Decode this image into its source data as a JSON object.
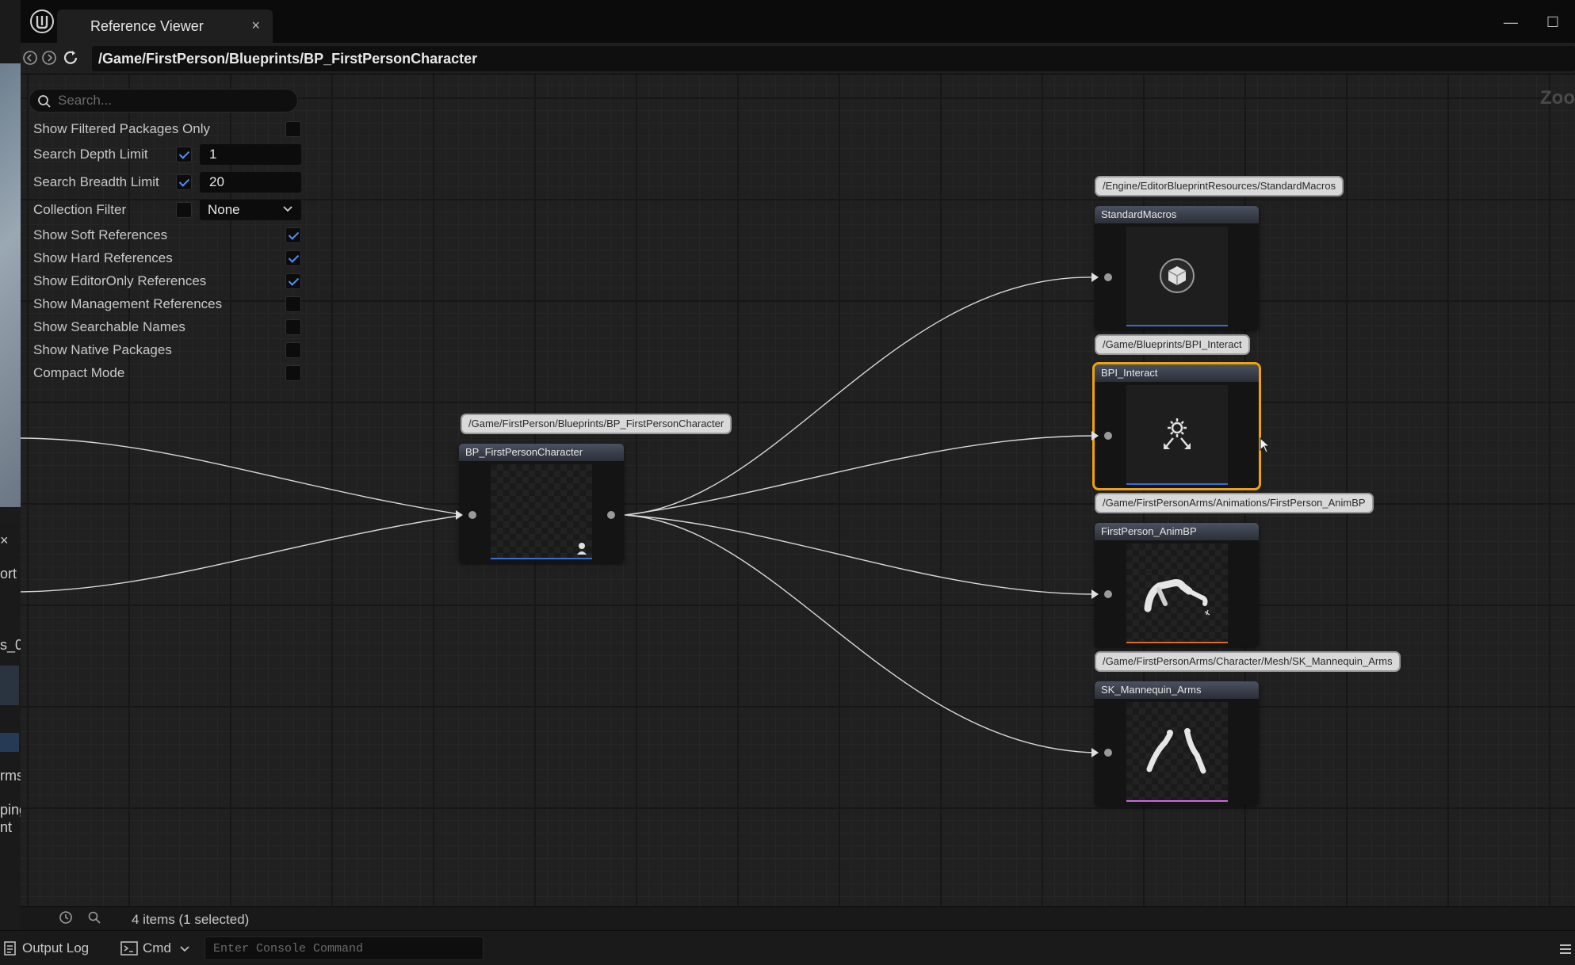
{
  "window": {
    "tab_title": "Reference Viewer",
    "tab_close": "×",
    "minimize": "—",
    "maximize": "☐"
  },
  "pathbar": {
    "path": "/Game/FirstPerson/Blueprints/BP_FirstPersonCharacter"
  },
  "graph": {
    "zoom_label": "Zoo"
  },
  "settings": {
    "search_placeholder": "Search...",
    "options": [
      {
        "label": "Show Filtered Packages Only",
        "checked": false
      },
      {
        "label": "Search Depth Limit",
        "checked": true,
        "value": "1"
      },
      {
        "label": "Search Breadth Limit",
        "checked": true,
        "value": "20"
      },
      {
        "label": "Collection Filter",
        "checked": false,
        "value": "None"
      },
      {
        "label": "Show Soft References",
        "checked": true
      },
      {
        "label": "Show Hard References",
        "checked": true
      },
      {
        "label": "Show EditorOnly References",
        "checked": true
      },
      {
        "label": "Show Management References",
        "checked": false
      },
      {
        "label": "Show Searchable Names",
        "checked": false
      },
      {
        "label": "Show Native Packages",
        "checked": false
      },
      {
        "label": "Compact Mode",
        "checked": false
      }
    ]
  },
  "nodes": {
    "root": {
      "path": "/Game/FirstPerson/Blueprints/BP_FirstPersonCharacter",
      "name": "BP_FirstPersonCharacter"
    },
    "deps": [
      {
        "path": "/Engine/EditorBlueprintResources/StandardMacros",
        "name": "StandardMacros",
        "icon": "cube-icon",
        "bar_color": "#3a6cd8"
      },
      {
        "path": "/Game/Blueprints/BPI_Interact",
        "name": "BPI_Interact",
        "icon": "interface-icon",
        "bar_color": "#3a6cd8",
        "selected": true
      },
      {
        "path": "/Game/FirstPersonArms/Animations/FirstPerson_AnimBP",
        "name": "FirstPerson_AnimBP",
        "icon": "arms-anim-icon",
        "bar_color": "#d86a2a"
      },
      {
        "path": "/Game/FirstPersonArms/Character/Mesh/SK_Mannequin_Arms",
        "name": "SK_Mannequin_Arms",
        "icon": "arms-mesh-icon",
        "bar_color": "#c76ad8"
      }
    ]
  },
  "status": {
    "count": "4 items (1 selected)"
  },
  "console": {
    "output_log": "Output Log",
    "cmd": "Cmd",
    "placeholder": "Enter Console Command"
  },
  "background_fragments": [
    "ort",
    "s_0",
    "rms",
    "ping",
    "nt"
  ]
}
